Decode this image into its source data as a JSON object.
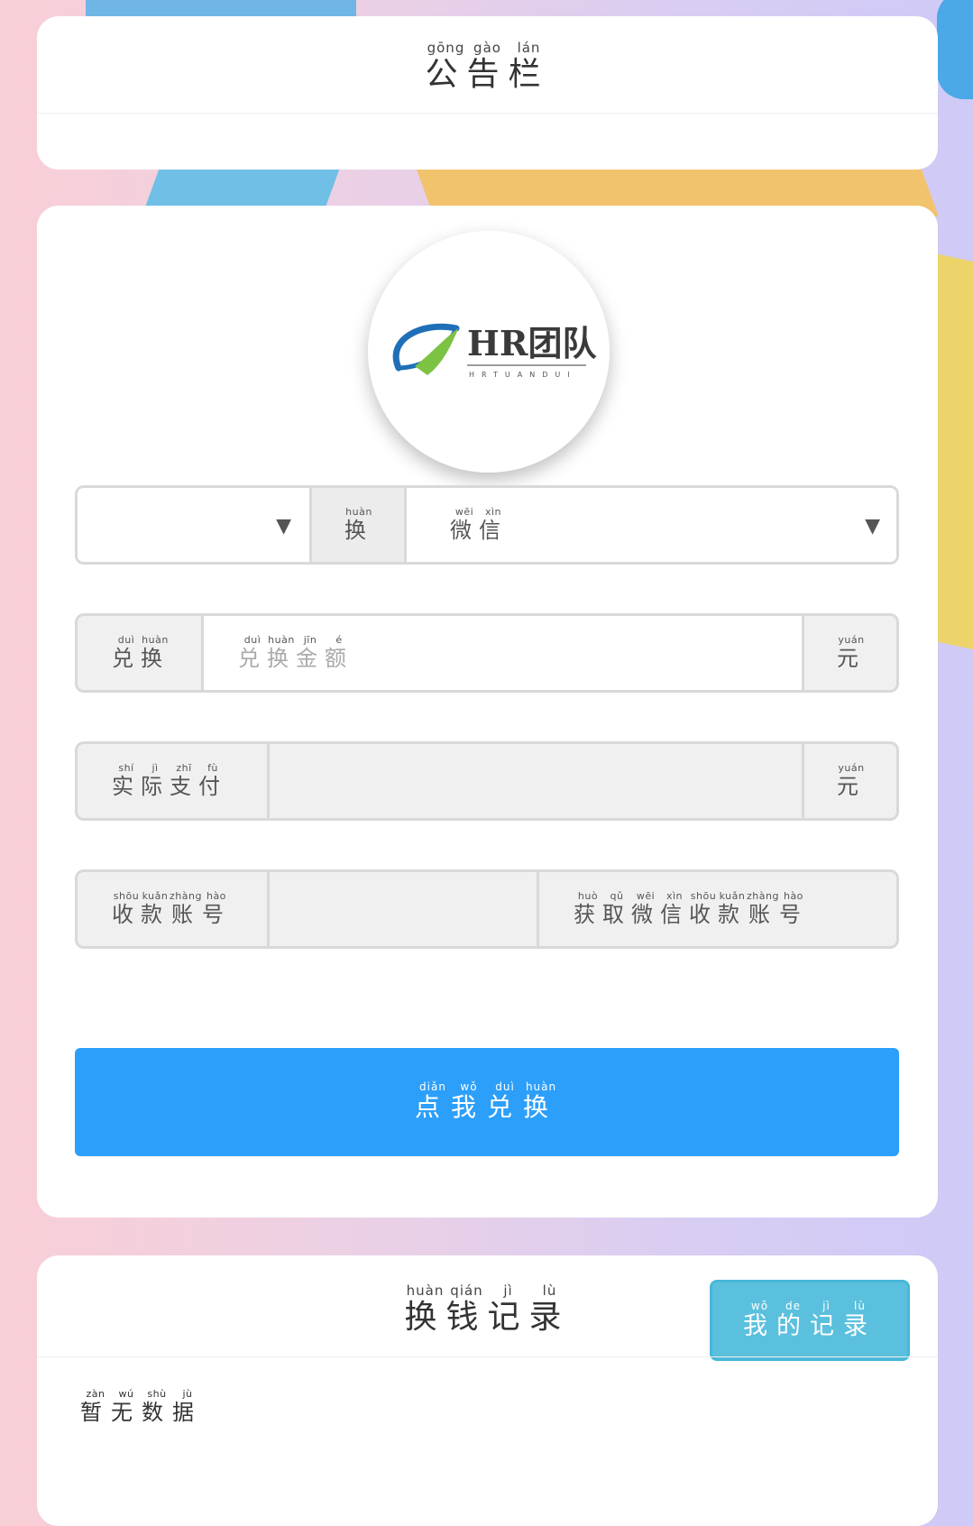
{
  "notice": {
    "title": [
      {
        "char": "公",
        "pinyin": "gōng"
      },
      {
        "char": "告",
        "pinyin": "gào"
      },
      {
        "char": "栏",
        "pinyin": "lán"
      }
    ]
  },
  "logo": {
    "brand_text": "HR团队",
    "brand_sub": "HRTUANDUI",
    "colors": {
      "blue": "#1f6fb8",
      "green": "#7cc243"
    }
  },
  "exchange_form": {
    "currency_select": {
      "value": ""
    },
    "swap_label": [
      {
        "char": "换",
        "pinyin": "huàn"
      }
    ],
    "method_select": {
      "value": [
        {
          "char": "微",
          "pinyin": "wēi"
        },
        {
          "char": "信",
          "pinyin": "xìn"
        }
      ]
    },
    "amount": {
      "label": [
        {
          "char": "兑",
          "pinyin": "duì"
        },
        {
          "char": "换",
          "pinyin": "huàn"
        }
      ],
      "placeholder": [
        {
          "char": "兑",
          "pinyin": "duì"
        },
        {
          "char": "换",
          "pinyin": "huàn"
        },
        {
          "char": "金",
          "pinyin": "jīn"
        },
        {
          "char": "额",
          "pinyin": "é"
        }
      ],
      "unit": [
        {
          "char": "元",
          "pinyin": "yuán"
        }
      ]
    },
    "actual_pay": {
      "label": [
        {
          "char": "实",
          "pinyin": "shí"
        },
        {
          "char": "际",
          "pinyin": "jì"
        },
        {
          "char": "支",
          "pinyin": "zhī"
        },
        {
          "char": "付",
          "pinyin": "fù"
        }
      ],
      "value": "",
      "unit": [
        {
          "char": "元",
          "pinyin": "yuán"
        }
      ]
    },
    "account": {
      "label": [
        {
          "char": "收",
          "pinyin": "shōu"
        },
        {
          "char": "款",
          "pinyin": "kuǎn"
        },
        {
          "char": "账",
          "pinyin": "zhàng"
        },
        {
          "char": "号",
          "pinyin": "hào"
        }
      ],
      "value": "",
      "get_button": [
        {
          "char": "获",
          "pinyin": "huò"
        },
        {
          "char": "取",
          "pinyin": "qǔ"
        },
        {
          "char": "微",
          "pinyin": "wēi"
        },
        {
          "char": "信",
          "pinyin": "xìn"
        },
        {
          "char": "收",
          "pinyin": "shōu"
        },
        {
          "char": "款",
          "pinyin": "kuǎn"
        },
        {
          "char": "账",
          "pinyin": "zhàng"
        },
        {
          "char": "号",
          "pinyin": "hào"
        }
      ]
    },
    "submit": [
      {
        "char": "点",
        "pinyin": "diǎn"
      },
      {
        "char": "我",
        "pinyin": "wǒ"
      },
      {
        "char": "兑",
        "pinyin": "duì"
      },
      {
        "char": "换",
        "pinyin": "huàn"
      }
    ],
    "colors": {
      "primary": "#2c9ffa",
      "info": "#5bc0de"
    }
  },
  "records": {
    "title": [
      {
        "char": "换",
        "pinyin": "huàn"
      },
      {
        "char": "钱",
        "pinyin": "qián"
      },
      {
        "char": "记",
        "pinyin": "jì"
      },
      {
        "char": "录",
        "pinyin": "lù"
      }
    ],
    "my_records_button": [
      {
        "char": "我",
        "pinyin": "wǒ"
      },
      {
        "char": "的",
        "pinyin": "de"
      },
      {
        "char": "记",
        "pinyin": "jì"
      },
      {
        "char": "录",
        "pinyin": "lù"
      }
    ],
    "empty_text": [
      {
        "char": "暂",
        "pinyin": "zàn"
      },
      {
        "char": "无",
        "pinyin": "wú"
      },
      {
        "char": "数",
        "pinyin": "shù"
      },
      {
        "char": "据",
        "pinyin": "jù"
      }
    ]
  }
}
